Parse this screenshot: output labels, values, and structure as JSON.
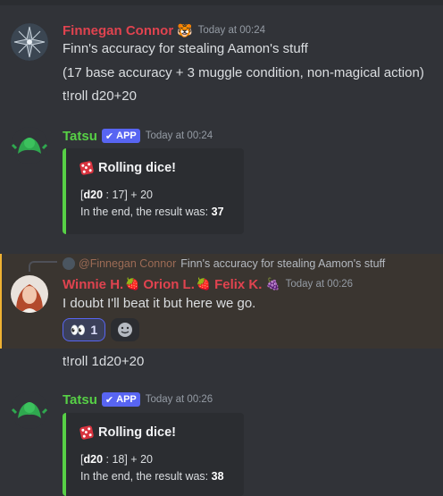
{
  "messages": [
    {
      "author": "Finnegan Connor",
      "author_color": "#e0434f",
      "time": "Today at 00:24",
      "lines": [
        "Finn's accuracy for stealing Aamon's stuff",
        "(17 base accuracy + 3 muggle condition, non-magical action)",
        "t!roll d20+20"
      ]
    },
    {
      "author": "Tatsu",
      "author_color": "#57d046",
      "badge": "APP",
      "time": "Today at 00:24",
      "embed": {
        "title": "Rolling dice!",
        "roll_open": "[",
        "roll_die": "d20",
        "roll_rest": " : 17] + 20",
        "result_prefix": "In the end, the result was: ",
        "result": "37"
      }
    },
    {
      "reply_to_author": "@Finnegan Connor",
      "reply_to_text": "Finn's accuracy for stealing Aamon's stuff",
      "author": "Winnie H.",
      "author_color": "#e0434f",
      "co_names": [
        "Orion L.",
        "Felix K."
      ],
      "time": "Today at 00:26",
      "lines": [
        "I doubt I'll beat it but here we go."
      ],
      "reaction_emoji": "👀",
      "reaction_count": "1",
      "add_reaction_icon": "add-reaction-icon"
    },
    {
      "lines": [
        "t!roll 1d20+20"
      ]
    },
    {
      "author": "Tatsu",
      "author_color": "#57d046",
      "badge": "APP",
      "time": "Today at 00:26",
      "embed": {
        "title": "Rolling dice!",
        "roll_open": "[",
        "roll_die": "d20",
        "roll_rest": " : 18] + 20",
        "result_prefix": "In the end, the result was: ",
        "result": "38"
      }
    }
  ],
  "colors": {
    "background": "#313338",
    "embed_bar": "#57d046",
    "app_badge": "#5865f2",
    "highlight": "#3a3530"
  }
}
